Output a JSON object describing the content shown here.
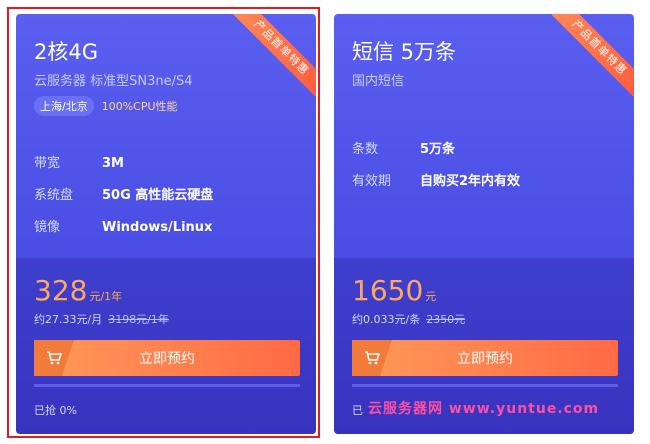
{
  "cards": [
    {
      "ribbon": "产品首单特惠",
      "title": "2核4G",
      "subtitle": "云服务器 标准型SN3ne/S4",
      "tag_region": "上海/北京",
      "tag_perf": "100%CPU性能",
      "specs": [
        {
          "k": "带宽",
          "v": "3M"
        },
        {
          "k": "系统盘",
          "v": "50G 高性能云硬盘"
        },
        {
          "k": "镜像",
          "v": "Windows/Linux"
        }
      ],
      "price": "328",
      "price_unit": "元/1年",
      "monthly": "约27.33元/月",
      "original": "3198元/1年",
      "button": "立即预约",
      "sold": "已抢 0%",
      "sold_fraction": 0
    },
    {
      "ribbon": "产品首单特惠",
      "title": "短信 5万条",
      "subtitle": "国内短信",
      "specs": [
        {
          "k": "条数",
          "v": "5万条"
        },
        {
          "k": "有效期",
          "v": "自购买2年内有效"
        }
      ],
      "price": "1650",
      "price_unit": "元",
      "monthly": "约0.033元/条",
      "original": "2350元",
      "button": "立即预约",
      "sold": "已",
      "sold_fraction": 0
    }
  ],
  "watermark": "云服务器网 www.yuntue.com",
  "colors": {
    "accent": "#ff7a45",
    "card_top": "#5a5ff0",
    "card_bottom": "#3833bf",
    "highlight": "#e01b24"
  }
}
